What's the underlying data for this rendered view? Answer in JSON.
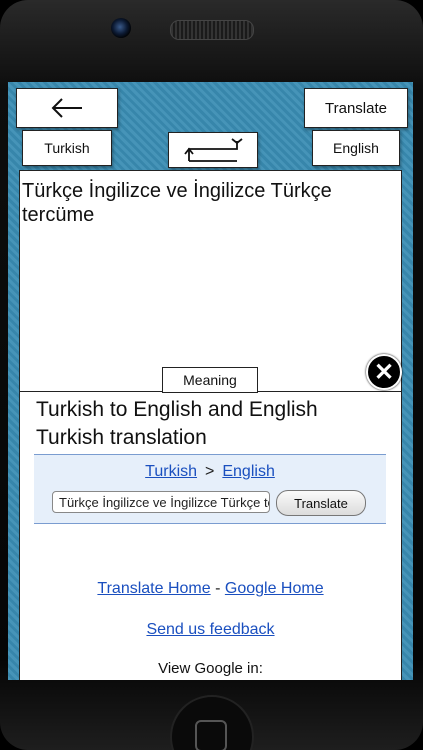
{
  "toolbar": {
    "translate_label": "Translate",
    "back_icon": "arrow-left-icon"
  },
  "languages": {
    "source": "Turkish",
    "target": "English",
    "swap_icon": "swap-arrows-icon"
  },
  "input": {
    "text": "Türkçe İngilizce ve İngilizce Türkçe tercüme"
  },
  "meaning_tab": "Meaning",
  "result": {
    "title": "Turkish to English and English Turkish translation",
    "lang_from": "Turkish",
    "lang_arrow": ">",
    "lang_to": "English",
    "query": "Türkçe İngilizce ve İngilizce Türkçe tercüme",
    "translate_button": "Translate",
    "link_translate_home": "Translate Home",
    "link_separator": "-",
    "link_google_home": "Google Home",
    "feedback": "Send us feedback",
    "view_in": "View Google in:"
  },
  "colors": {
    "background": "#3a8db4",
    "link": "#1a4fbf"
  }
}
